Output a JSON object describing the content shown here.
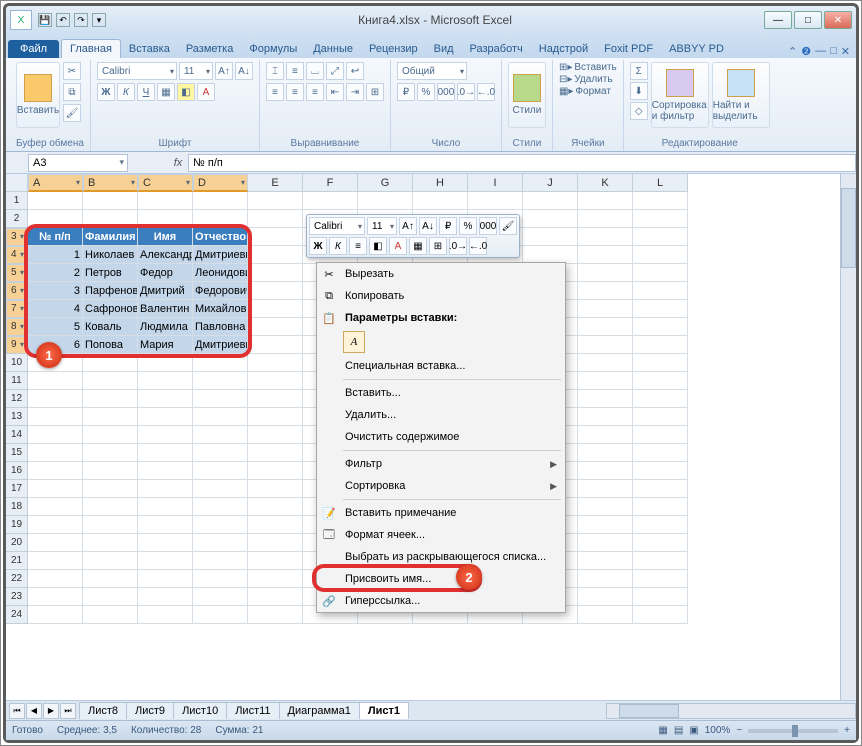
{
  "window": {
    "title_doc": "Книга4.xlsx",
    "title_app": "Microsoft Excel"
  },
  "tabs": {
    "file": "Файл",
    "items": [
      "Главная",
      "Вставка",
      "Разметка",
      "Формулы",
      "Данные",
      "Рецензир",
      "Вид",
      "Разработч",
      "Надстрой",
      "Foxit PDF",
      "ABBYY PD"
    ],
    "active_index": 0
  },
  "ribbon": {
    "clipboard": {
      "paste": "Вставить",
      "label": "Буфер обмена"
    },
    "font": {
      "name": "Calibri",
      "size": "11",
      "label": "Шрифт",
      "bold": "Ж",
      "italic": "К",
      "underline": "Ч"
    },
    "alignment": {
      "label": "Выравнивание"
    },
    "number": {
      "format": "Общий",
      "label": "Число"
    },
    "styles": {
      "btn": "Стили",
      "label": "Стили"
    },
    "cells": {
      "insert": "Вставить",
      "delete": "Удалить",
      "format": "Формат",
      "label": "Ячейки"
    },
    "editing": {
      "sort": "Сортировка и фильтр",
      "find": "Найти и выделить",
      "label": "Редактирование"
    }
  },
  "namebox": "A3",
  "formula": "№ п/п",
  "columns": [
    "A",
    "B",
    "C",
    "D",
    "E",
    "F",
    "G",
    "H",
    "I",
    "J",
    "K",
    "L"
  ],
  "selected_cols": [
    0,
    1,
    2,
    3
  ],
  "rows_visible": 24,
  "selected_rows": [
    3,
    4,
    5,
    6,
    7,
    8,
    9
  ],
  "table": {
    "header_row": 3,
    "headers": [
      "№ п/п",
      "Фамилия",
      "Имя",
      "Отчество"
    ],
    "data": [
      [
        "1",
        "Николаев",
        "Александр",
        "Дмитриевич"
      ],
      [
        "2",
        "Петров",
        "Федор",
        "Леонидович"
      ],
      [
        "3",
        "Парфенов",
        "Дмитрий",
        "Федорович"
      ],
      [
        "4",
        "Сафронов",
        "Валентин",
        "Михайлович"
      ],
      [
        "5",
        "Коваль",
        "Людмила",
        "Павловна"
      ],
      [
        "6",
        "Попова",
        "Мария",
        "Дмитриевна"
      ]
    ]
  },
  "minitoolbar": {
    "font": "Calibri",
    "size": "11",
    "bold": "Ж",
    "italic": "К",
    "currency": "%",
    "decimals": ".0"
  },
  "contextmenu": {
    "cut": "Вырезать",
    "copy": "Копировать",
    "paste_options_hdr": "Параметры вставки:",
    "paste_A": "A",
    "paste_special": "Специальная вставка...",
    "insert": "Вставить...",
    "delete": "Удалить...",
    "clear": "Очистить содержимое",
    "filter": "Фильтр",
    "sort": "Сортировка",
    "comment": "Вставить примечание",
    "format_cells": "Формат ячеек...",
    "pick_list": "Выбрать из раскрывающегося списка...",
    "define_name": "Присвоить имя...",
    "hyperlink": "Гиперссылка..."
  },
  "sheets": {
    "list": [
      "Лист8",
      "Лист9",
      "Лист10",
      "Лист11",
      "Диаграмма1",
      "Лист1"
    ],
    "active": "Лист1"
  },
  "statusbar": {
    "ready": "Готово",
    "avg_label": "Среднее:",
    "avg_val": "3,5",
    "count_label": "Количество:",
    "count_val": "28",
    "sum_label": "Сумма:",
    "sum_val": "21",
    "zoom": "100%"
  },
  "callouts": {
    "one": "1",
    "two": "2"
  }
}
